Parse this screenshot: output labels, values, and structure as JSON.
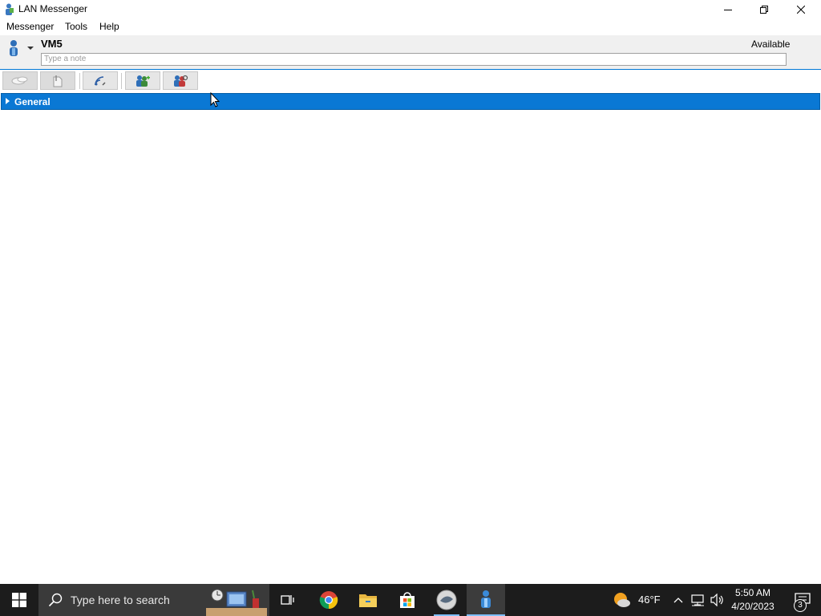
{
  "window": {
    "title": "LAN Messenger",
    "controls": [
      "minimize-icon",
      "restore-icon",
      "close-icon"
    ]
  },
  "menu": {
    "items": [
      {
        "label": "Messenger"
      },
      {
        "label": "Tools"
      },
      {
        "label": "Help"
      }
    ]
  },
  "header": {
    "username": "VM5",
    "status": "Available",
    "note_placeholder": "Type a note"
  },
  "toolbar": {
    "buttons": [
      {
        "icon": "chat-icon",
        "enabled": false
      },
      {
        "icon": "file-transfer-icon",
        "enabled": false
      },
      {
        "icon": "broadcast-icon",
        "enabled": true
      },
      {
        "icon": "add-group-icon",
        "enabled": true
      },
      {
        "icon": "group-settings-icon",
        "enabled": true
      }
    ]
  },
  "contacts": {
    "groups": [
      {
        "name": "General",
        "expanded": false,
        "selected": true
      }
    ]
  },
  "taskbar": {
    "search_placeholder": "Type here to search",
    "apps": [
      "task-view-icon",
      "chrome-icon",
      "file-explorer-icon",
      "store-icon",
      "app-icon",
      "lan-messenger-icon"
    ],
    "weather_temp": "46°F",
    "time": "5:50 AM",
    "date": "4/20/2023",
    "notification_count": "3"
  },
  "colors": {
    "accent": "#0078d7",
    "group_bg": "#0a78d4",
    "taskbar_bg": "#1c1c1c"
  }
}
